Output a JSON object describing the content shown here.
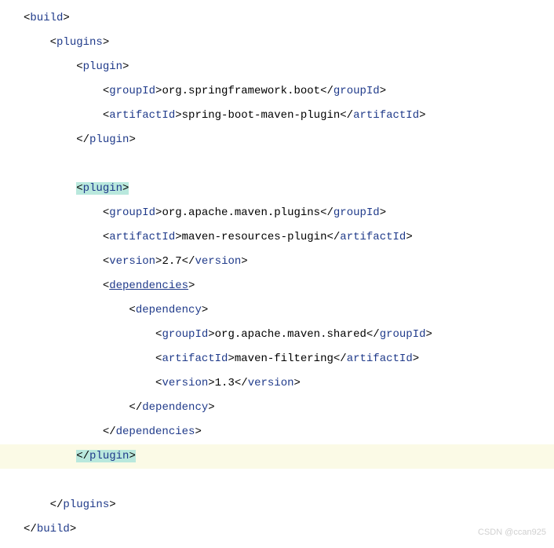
{
  "code": {
    "l01_tag": "build",
    "l02_tag": "plugins",
    "l03_tag": "plugin",
    "l04_tag": "groupId",
    "l04_text": "org.springframework.boot",
    "l05_tag": "artifactId",
    "l05_text": "spring-boot-maven-plugin",
    "l06_tag": "plugin",
    "l07_tag": "plugin",
    "l08_tag": "groupId",
    "l08_text": "org.apache.maven.plugins",
    "l09_tag": "artifactId",
    "l09_text": "maven-resources-plugin",
    "l10_tag": "version",
    "l10_text": "2.7",
    "l11_tag": "dependencies",
    "l12_tag": "dependency",
    "l13_tag": "groupId",
    "l13_text": "org.apache.maven.shared",
    "l14_tag": "artifactId",
    "l14_text": "maven-filtering",
    "l15_tag": "version",
    "l15_text": "1.3",
    "l16_tag": "dependency",
    "l17_tag": "dependencies",
    "l18_tag": "plugin",
    "l19_tag": "plugins",
    "l20_tag": "build"
  },
  "watermark": "CSDN @ccan925"
}
